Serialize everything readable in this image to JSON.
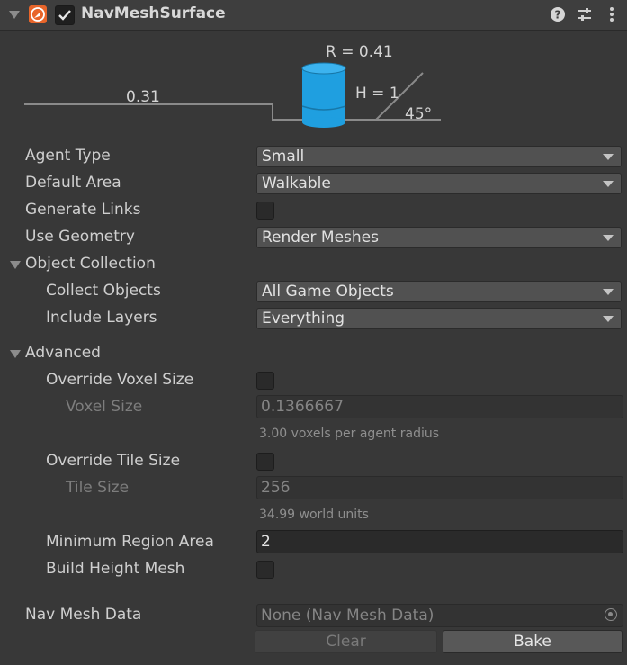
{
  "component": {
    "title": "NavMeshSurface",
    "enabled": true
  },
  "agent_diagram": {
    "radius_label": "R = 0.41",
    "height_label": "H = 1",
    "step_label": "0.31",
    "slope_label": "45°",
    "cylinder_color": "#1f9fe0"
  },
  "fields": {
    "agent_type": {
      "label": "Agent Type",
      "value": "Small"
    },
    "default_area": {
      "label": "Default Area",
      "value": "Walkable"
    },
    "generate_links": {
      "label": "Generate Links",
      "checked": false
    },
    "use_geometry": {
      "label": "Use Geometry",
      "value": "Render Meshes"
    }
  },
  "object_collection": {
    "label": "Object Collection",
    "collect_objects": {
      "label": "Collect Objects",
      "value": "All Game Objects"
    },
    "include_layers": {
      "label": "Include Layers",
      "value": "Everything"
    }
  },
  "advanced": {
    "label": "Advanced",
    "override_voxel_size": {
      "label": "Override Voxel Size",
      "checked": false
    },
    "voxel_size": {
      "label": "Voxel Size",
      "value": "0.1366667",
      "hint": "3.00 voxels per agent radius"
    },
    "override_tile_size": {
      "label": "Override Tile Size",
      "checked": false
    },
    "tile_size": {
      "label": "Tile Size",
      "value": "256",
      "hint": "34.99 world units"
    },
    "minimum_region_area": {
      "label": "Minimum Region Area",
      "value": "2"
    },
    "build_height_mesh": {
      "label": "Build Height Mesh",
      "checked": false
    }
  },
  "nav_mesh_data": {
    "label": "Nav Mesh Data",
    "value": "None (Nav Mesh Data)"
  },
  "buttons": {
    "clear": "Clear",
    "bake": "Bake"
  },
  "icons": [
    "foldout-arrow-icon",
    "navmesh-component-icon",
    "checkmark-icon",
    "help-icon",
    "presets-icon",
    "more-icon",
    "object-picker-icon"
  ]
}
